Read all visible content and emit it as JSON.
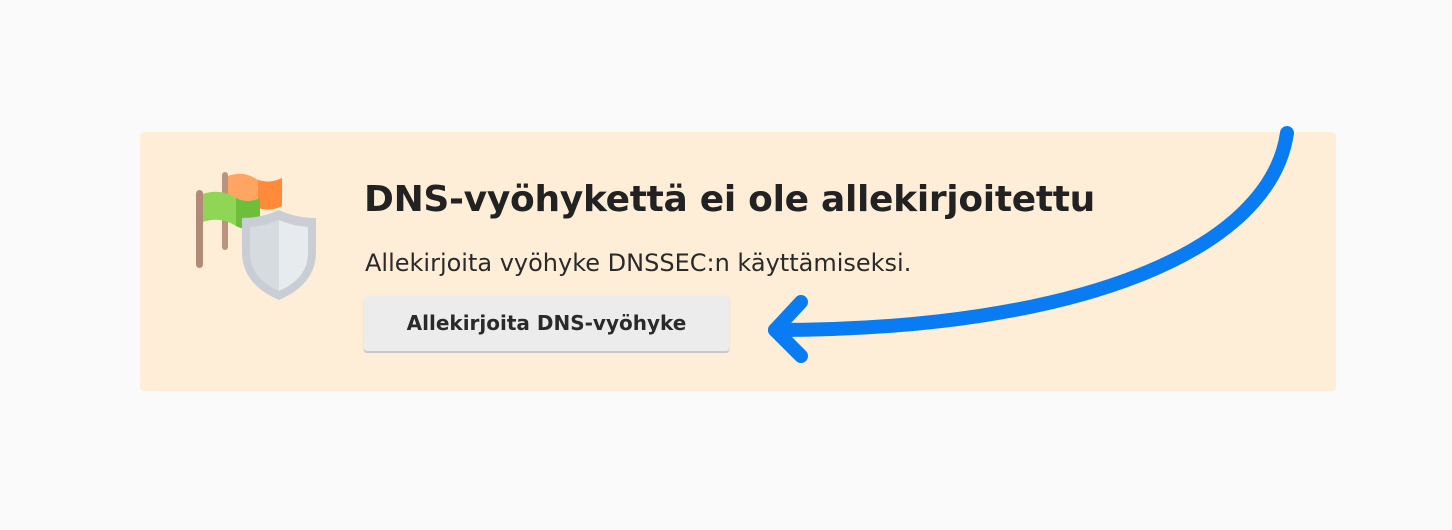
{
  "banner": {
    "title": "DNS-vyöhykettä ei ole allekirjoitettu",
    "subtitle": "Allekirjoita vyöhyke DNSSEC:n käyttämiseksi.",
    "button_label": "Allekirjoita DNS-vyöhyke",
    "background_color": "#feeed8",
    "icon": "flags-shield-icon"
  },
  "annotation": {
    "icon": "curved-arrow-icon",
    "color": "#0a7cf3"
  }
}
